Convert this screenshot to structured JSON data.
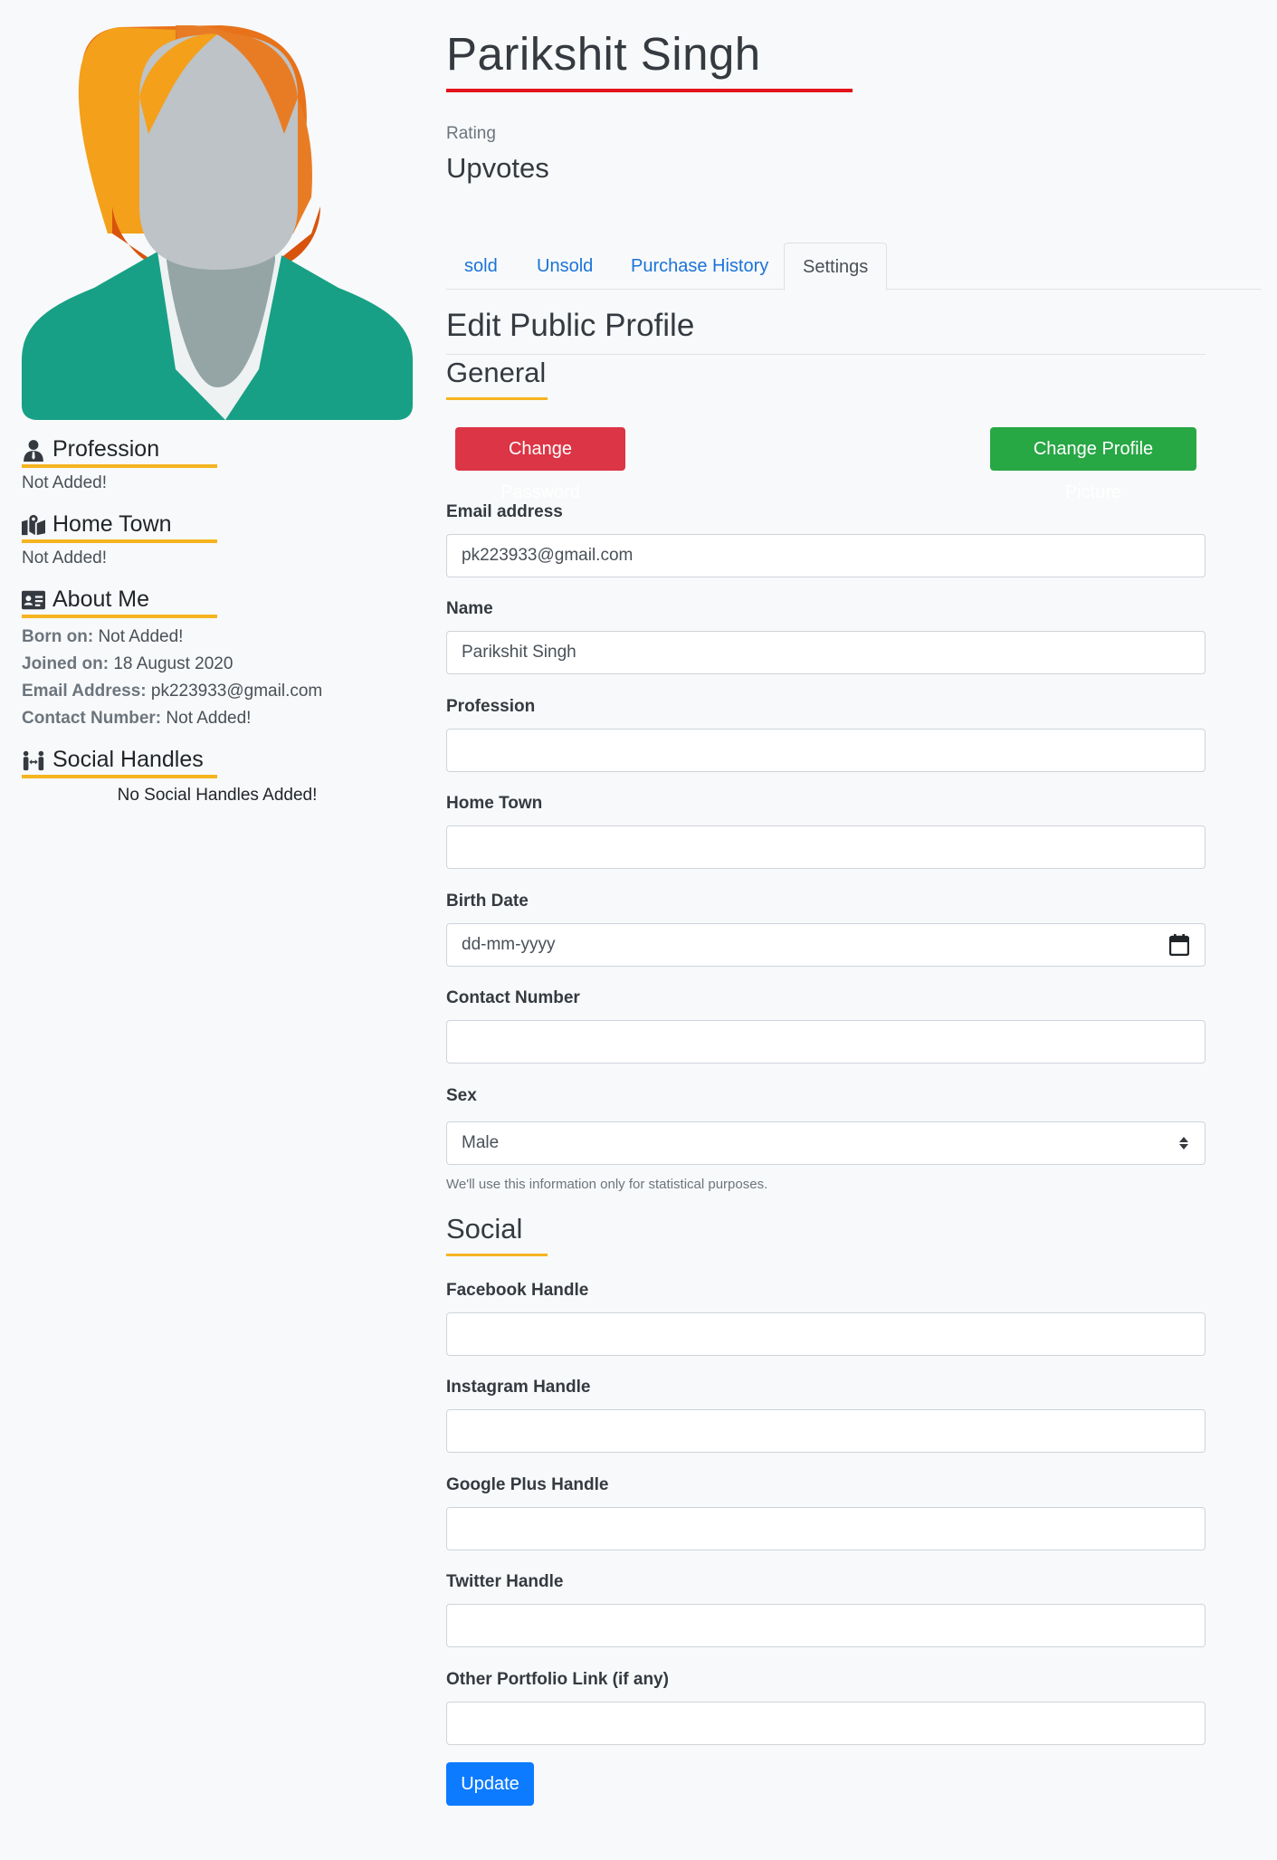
{
  "profile": {
    "name": "Parikshit Singh",
    "rating_label": "Rating",
    "rating_value": "Upvotes"
  },
  "sidebar": {
    "profession": {
      "heading": "Profession",
      "value": "Not Added!"
    },
    "hometown": {
      "heading": "Home Town",
      "value": "Not Added!"
    },
    "about": {
      "heading": "About Me",
      "born_label": "Born on:",
      "born_value": "Not Added!",
      "joined_label": "Joined on:",
      "joined_value": "18 August 2020",
      "email_label": "Email Address:",
      "email_value": "pk223933@gmail.com",
      "contact_label": "Contact Number:",
      "contact_value": "Not Added!"
    },
    "social": {
      "heading": "Social Handles",
      "empty": "No Social Handles Added!"
    }
  },
  "tabs": [
    {
      "label": "sold"
    },
    {
      "label": "Unsold"
    },
    {
      "label": "Purchase History"
    },
    {
      "label": "Settings"
    }
  ],
  "form": {
    "title": "Edit Public Profile",
    "general_heading": "General",
    "change_password": "Change Password",
    "change_picture": "Change Profile Picture",
    "email": {
      "label": "Email address",
      "value": "pk223933@gmail.com"
    },
    "name": {
      "label": "Name",
      "value": "Parikshit Singh"
    },
    "profession": {
      "label": "Profession",
      "value": ""
    },
    "hometown": {
      "label": "Home Town",
      "value": ""
    },
    "birthdate": {
      "label": "Birth Date",
      "placeholder": "dd-mm-yyyy"
    },
    "contact": {
      "label": "Contact Number",
      "value": ""
    },
    "sex": {
      "label": "Sex",
      "value": "Male",
      "help": "We'll use this information only for statistical purposes."
    },
    "social_heading": "Social",
    "facebook": {
      "label": "Facebook Handle",
      "value": ""
    },
    "instagram": {
      "label": "Instagram Handle",
      "value": ""
    },
    "googleplus": {
      "label": "Google Plus Handle",
      "value": ""
    },
    "twitter": {
      "label": "Twitter Handle",
      "value": ""
    },
    "portfolio": {
      "label": "Other Portfolio Link (if any)",
      "value": ""
    },
    "update": "Update"
  },
  "colors": {
    "accent_underline": "#f6b420",
    "name_underline": "#e3141b",
    "link": "#1a73d9",
    "danger": "#dc3545",
    "success": "#28a745",
    "primary": "#0d7bff"
  }
}
